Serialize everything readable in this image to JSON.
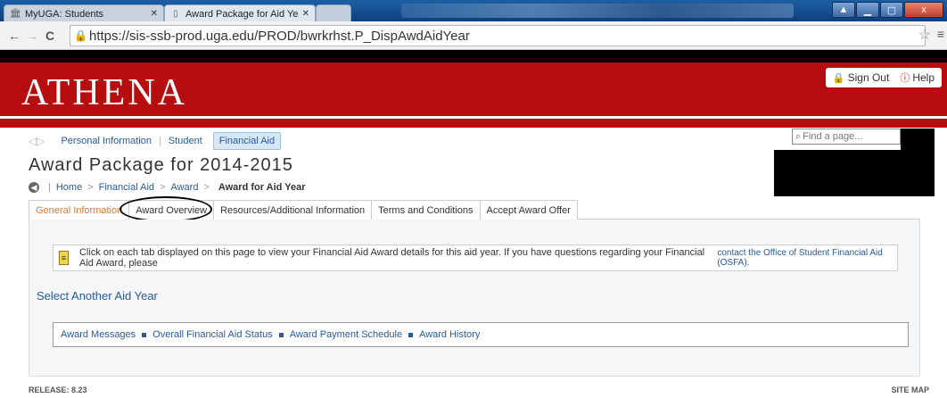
{
  "browser": {
    "tabs": [
      {
        "title": "MyUGA: Students",
        "icon": "building-icon"
      },
      {
        "title": "Award Package for Aid Ye",
        "icon": "page-icon"
      }
    ],
    "url": "https://sis-ssb-prod.uga.edu/PROD/bwrkrhst.P_DispAwdAidYear",
    "window_buttons": {
      "minimize": "▁",
      "maximize": "▢",
      "close": "x"
    }
  },
  "header": {
    "logo": "ATHENA",
    "sign_out": "Sign Out",
    "help": "Help"
  },
  "nav": {
    "items": [
      "Personal Information",
      "Student",
      "Financial Aid"
    ],
    "search_placeholder": "Find a page..."
  },
  "page_title": "Award Package for 2014-2015",
  "breadcrumb": {
    "home": "Home",
    "financial_aid": "Financial Aid",
    "award": "Award",
    "current": "Award for Aid Year"
  },
  "tabs": [
    "General Information",
    "Award Overview",
    "Resources/Additional Information",
    "Terms and Conditions",
    "Accept Award Offer"
  ],
  "info": {
    "text": "Click on each tab displayed on this page to view your Financial Aid Award details for this aid year. If you have questions regarding your Financial Aid Award, please",
    "link": "contact the Office of Student Financial Aid (OSFA)."
  },
  "select_link": "Select Another Aid Year",
  "links": [
    "Award Messages",
    "Overall Financial Aid Status",
    "Award Payment Schedule",
    "Award History"
  ],
  "footer": {
    "release": "RELEASE: 8.23",
    "sitemap": "SITE MAP"
  },
  "colors": {
    "banner_red": "#b60e0e",
    "link_blue": "#2a5a9a",
    "active_tab_orange": "#e07a2a"
  }
}
